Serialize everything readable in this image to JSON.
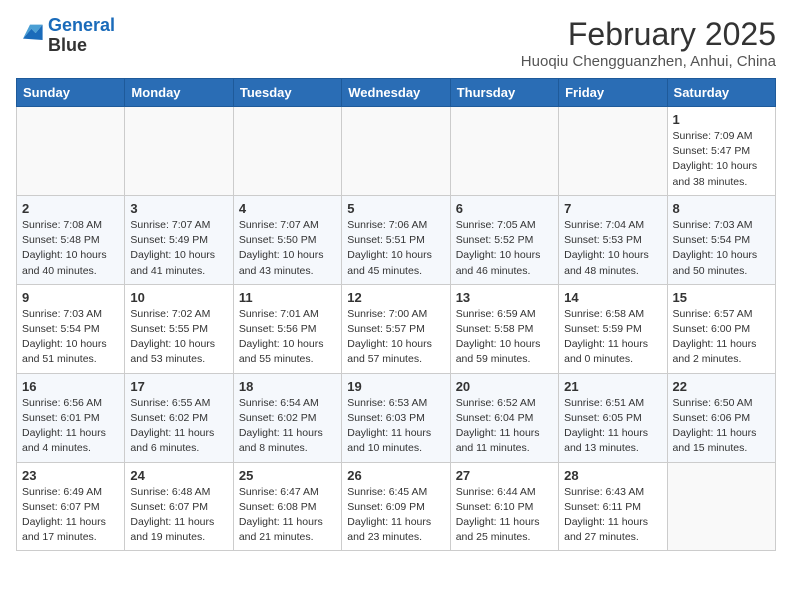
{
  "header": {
    "logo_line1": "General",
    "logo_line2": "Blue",
    "month": "February 2025",
    "location": "Huoqiu Chengguanzhen, Anhui, China"
  },
  "weekdays": [
    "Sunday",
    "Monday",
    "Tuesday",
    "Wednesday",
    "Thursday",
    "Friday",
    "Saturday"
  ],
  "weeks": [
    [
      {
        "day": "",
        "info": ""
      },
      {
        "day": "",
        "info": ""
      },
      {
        "day": "",
        "info": ""
      },
      {
        "day": "",
        "info": ""
      },
      {
        "day": "",
        "info": ""
      },
      {
        "day": "",
        "info": ""
      },
      {
        "day": "1",
        "info": "Sunrise: 7:09 AM\nSunset: 5:47 PM\nDaylight: 10 hours\nand 38 minutes."
      }
    ],
    [
      {
        "day": "2",
        "info": "Sunrise: 7:08 AM\nSunset: 5:48 PM\nDaylight: 10 hours\nand 40 minutes."
      },
      {
        "day": "3",
        "info": "Sunrise: 7:07 AM\nSunset: 5:49 PM\nDaylight: 10 hours\nand 41 minutes."
      },
      {
        "day": "4",
        "info": "Sunrise: 7:07 AM\nSunset: 5:50 PM\nDaylight: 10 hours\nand 43 minutes."
      },
      {
        "day": "5",
        "info": "Sunrise: 7:06 AM\nSunset: 5:51 PM\nDaylight: 10 hours\nand 45 minutes."
      },
      {
        "day": "6",
        "info": "Sunrise: 7:05 AM\nSunset: 5:52 PM\nDaylight: 10 hours\nand 46 minutes."
      },
      {
        "day": "7",
        "info": "Sunrise: 7:04 AM\nSunset: 5:53 PM\nDaylight: 10 hours\nand 48 minutes."
      },
      {
        "day": "8",
        "info": "Sunrise: 7:03 AM\nSunset: 5:54 PM\nDaylight: 10 hours\nand 50 minutes."
      }
    ],
    [
      {
        "day": "9",
        "info": "Sunrise: 7:03 AM\nSunset: 5:54 PM\nDaylight: 10 hours\nand 51 minutes."
      },
      {
        "day": "10",
        "info": "Sunrise: 7:02 AM\nSunset: 5:55 PM\nDaylight: 10 hours\nand 53 minutes."
      },
      {
        "day": "11",
        "info": "Sunrise: 7:01 AM\nSunset: 5:56 PM\nDaylight: 10 hours\nand 55 minutes."
      },
      {
        "day": "12",
        "info": "Sunrise: 7:00 AM\nSunset: 5:57 PM\nDaylight: 10 hours\nand 57 minutes."
      },
      {
        "day": "13",
        "info": "Sunrise: 6:59 AM\nSunset: 5:58 PM\nDaylight: 10 hours\nand 59 minutes."
      },
      {
        "day": "14",
        "info": "Sunrise: 6:58 AM\nSunset: 5:59 PM\nDaylight: 11 hours\nand 0 minutes."
      },
      {
        "day": "15",
        "info": "Sunrise: 6:57 AM\nSunset: 6:00 PM\nDaylight: 11 hours\nand 2 minutes."
      }
    ],
    [
      {
        "day": "16",
        "info": "Sunrise: 6:56 AM\nSunset: 6:01 PM\nDaylight: 11 hours\nand 4 minutes."
      },
      {
        "day": "17",
        "info": "Sunrise: 6:55 AM\nSunset: 6:02 PM\nDaylight: 11 hours\nand 6 minutes."
      },
      {
        "day": "18",
        "info": "Sunrise: 6:54 AM\nSunset: 6:02 PM\nDaylight: 11 hours\nand 8 minutes."
      },
      {
        "day": "19",
        "info": "Sunrise: 6:53 AM\nSunset: 6:03 PM\nDaylight: 11 hours\nand 10 minutes."
      },
      {
        "day": "20",
        "info": "Sunrise: 6:52 AM\nSunset: 6:04 PM\nDaylight: 11 hours\nand 11 minutes."
      },
      {
        "day": "21",
        "info": "Sunrise: 6:51 AM\nSunset: 6:05 PM\nDaylight: 11 hours\nand 13 minutes."
      },
      {
        "day": "22",
        "info": "Sunrise: 6:50 AM\nSunset: 6:06 PM\nDaylight: 11 hours\nand 15 minutes."
      }
    ],
    [
      {
        "day": "23",
        "info": "Sunrise: 6:49 AM\nSunset: 6:07 PM\nDaylight: 11 hours\nand 17 minutes."
      },
      {
        "day": "24",
        "info": "Sunrise: 6:48 AM\nSunset: 6:07 PM\nDaylight: 11 hours\nand 19 minutes."
      },
      {
        "day": "25",
        "info": "Sunrise: 6:47 AM\nSunset: 6:08 PM\nDaylight: 11 hours\nand 21 minutes."
      },
      {
        "day": "26",
        "info": "Sunrise: 6:45 AM\nSunset: 6:09 PM\nDaylight: 11 hours\nand 23 minutes."
      },
      {
        "day": "27",
        "info": "Sunrise: 6:44 AM\nSunset: 6:10 PM\nDaylight: 11 hours\nand 25 minutes."
      },
      {
        "day": "28",
        "info": "Sunrise: 6:43 AM\nSunset: 6:11 PM\nDaylight: 11 hours\nand 27 minutes."
      },
      {
        "day": "",
        "info": ""
      }
    ]
  ]
}
